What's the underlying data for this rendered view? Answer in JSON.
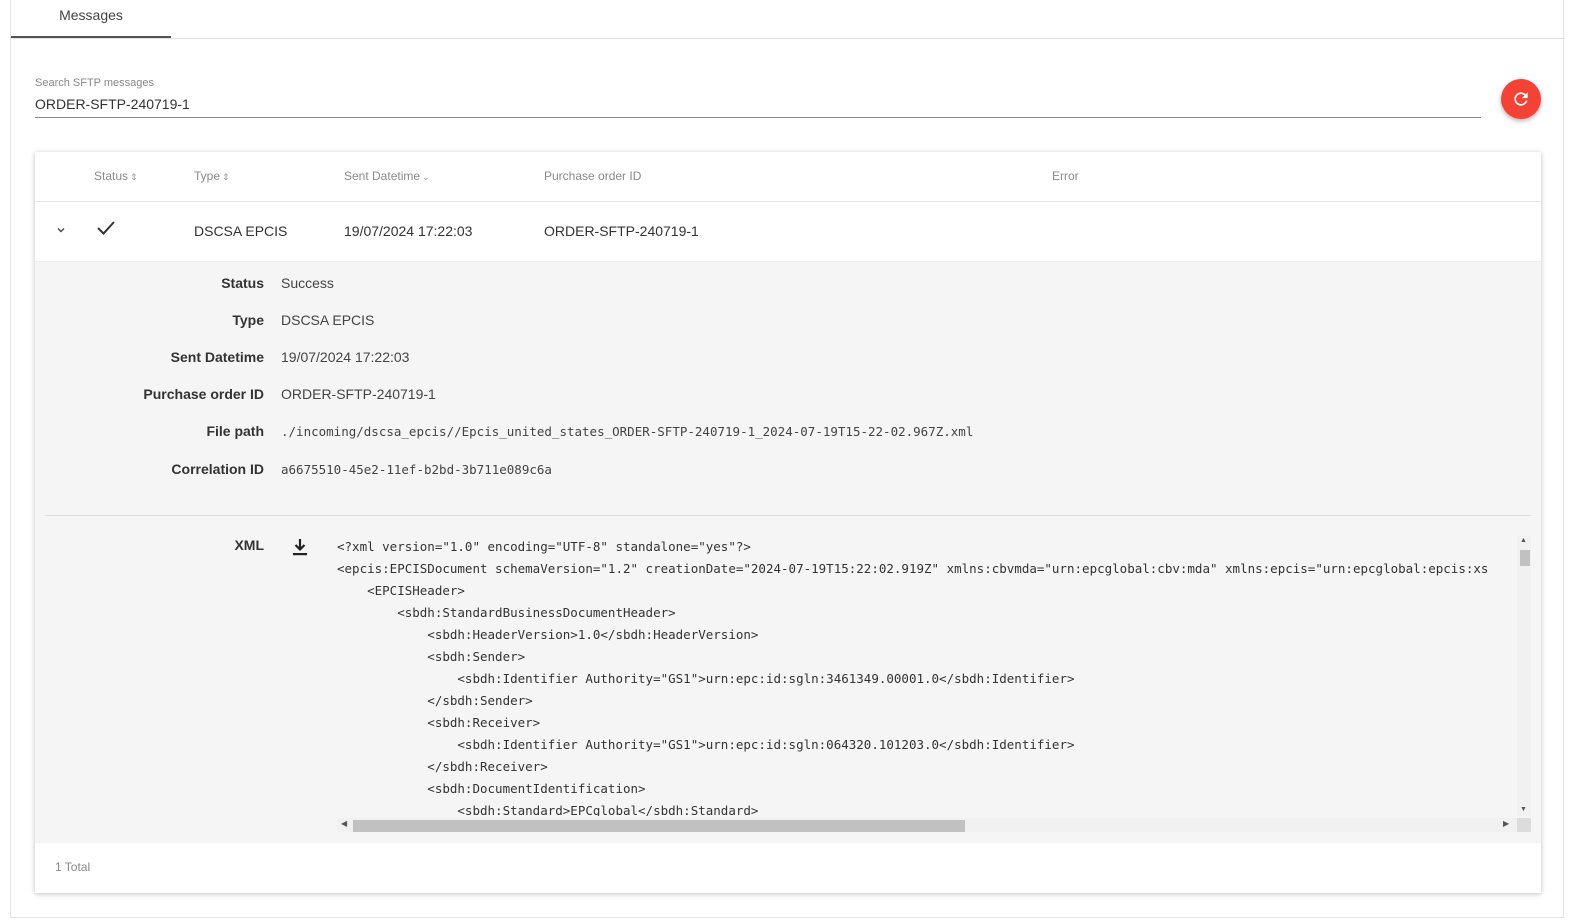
{
  "tabs": [
    {
      "label": "Messages",
      "active": true
    }
  ],
  "search": {
    "label": "Search SFTP messages",
    "value": "ORDER-SFTP-240719-1"
  },
  "colors": {
    "accent": "#f44336",
    "detail_bg": "#f5f5f5"
  },
  "table": {
    "columns": {
      "status": "Status",
      "type": "Type",
      "sent": "Sent Datetime",
      "po": "Purchase order ID",
      "error": "Error"
    },
    "sort_icons": {
      "status": "⇕",
      "type": "⇕",
      "sent": "⌄"
    },
    "row": {
      "type": "DSCSA EPCIS",
      "sent": "19/07/2024 17:22:03",
      "po": "ORDER-SFTP-240719-1",
      "error": ""
    },
    "footer": "1 Total"
  },
  "detail": {
    "fields": [
      {
        "label": "Status",
        "value": "Success"
      },
      {
        "label": "Type",
        "value": "DSCSA EPCIS"
      },
      {
        "label": "Sent Datetime",
        "value": "19/07/2024 17:22:03"
      },
      {
        "label": "Purchase order ID",
        "value": "ORDER-SFTP-240719-1"
      },
      {
        "label": "File path",
        "value": "./incoming/dscsa_epcis//Epcis_united_states_ORDER-SFTP-240719-1_2024-07-19T15-22-02.967Z.xml"
      },
      {
        "label": "Correlation ID",
        "value": "a6675510-45e2-11ef-b2bd-3b711e089c6a"
      }
    ],
    "xml_label": "XML",
    "xml_lines": [
      "<?xml version=\"1.0\" encoding=\"UTF-8\" standalone=\"yes\"?>",
      "<epcis:EPCISDocument schemaVersion=\"1.2\" creationDate=\"2024-07-19T15:22:02.919Z\" xmlns:cbvmda=\"urn:epcglobal:cbv:mda\" xmlns:epcis=\"urn:epcglobal:epcis:xs",
      "    <EPCISHeader>",
      "        <sbdh:StandardBusinessDocumentHeader>",
      "            <sbdh:HeaderVersion>1.0</sbdh:HeaderVersion>",
      "            <sbdh:Sender>",
      "                <sbdh:Identifier Authority=\"GS1\">urn:epc:id:sgln:3461349.00001.0</sbdh:Identifier>",
      "            </sbdh:Sender>",
      "            <sbdh:Receiver>",
      "                <sbdh:Identifier Authority=\"GS1\">urn:epc:id:sgln:064320.101203.0</sbdh:Identifier>",
      "            </sbdh:Receiver>",
      "            <sbdh:DocumentIdentification>",
      "                <sbdh:Standard>EPCglobal</sbdh:Standard>"
    ]
  }
}
